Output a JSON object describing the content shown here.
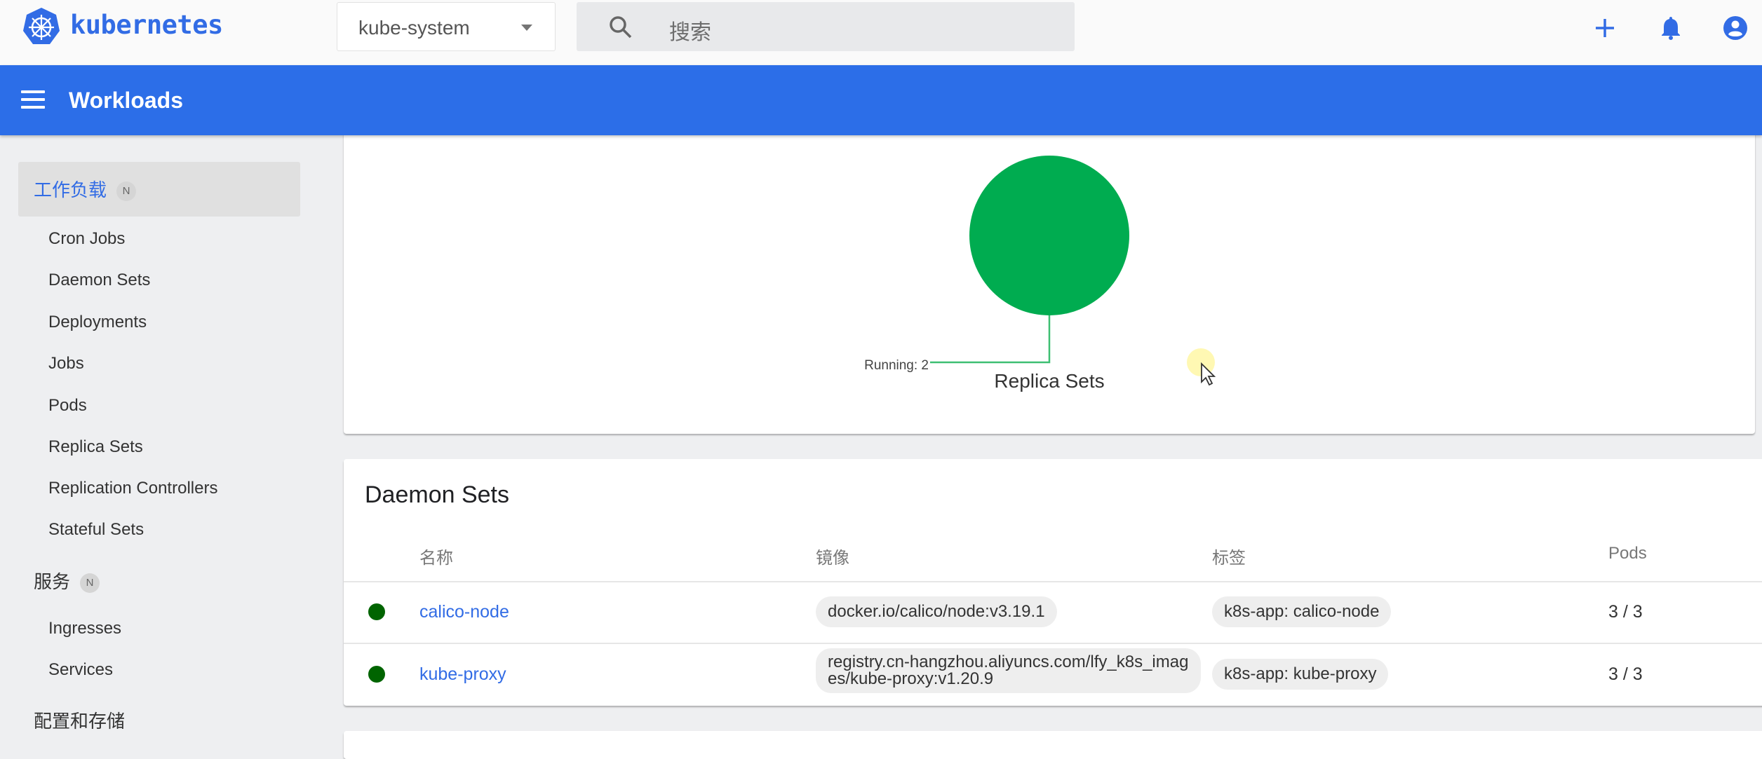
{
  "app": {
    "brand": "kubernetes",
    "brand_color": "#326ce5",
    "namespace_select": {
      "value": "kube-system"
    },
    "search": {
      "placeholder": "搜索"
    },
    "toolbar_icons": [
      "plus-icon",
      "bell-icon",
      "account-icon"
    ]
  },
  "appbar": {
    "title": "Workloads",
    "color": "#2c6ee8"
  },
  "sidebar": {
    "sections": [
      {
        "label": "工作负载",
        "badge": "N",
        "active": true,
        "items": [
          "Cron Jobs",
          "Daemon Sets",
          "Deployments",
          "Jobs",
          "Pods",
          "Replica Sets",
          "Replication Controllers",
          "Stateful Sets"
        ]
      },
      {
        "label": "服务",
        "badge": "N",
        "active": false,
        "items": [
          "Ingresses",
          "Services"
        ]
      },
      {
        "label": "配置和存储",
        "active": false,
        "items": []
      }
    ]
  },
  "replica_sets_chart": {
    "title": "Replica Sets",
    "label": "Running: 2"
  },
  "chart_data": {
    "type": "pie",
    "title": "Replica Sets",
    "slices": [
      {
        "label": "Running",
        "value": 2,
        "color": "#00ac50"
      }
    ],
    "annotations": [
      "Running: 2"
    ]
  },
  "daemon_sets": {
    "title": "Daemon Sets",
    "columns": [
      "名称",
      "镜像",
      "标签",
      "Pods"
    ],
    "rows": [
      {
        "status": "running",
        "name": "calico-node",
        "image": "docker.io/calico/node:v3.19.1",
        "label": "k8s-app: calico-node",
        "pods": "3 / 3"
      },
      {
        "status": "running",
        "name": "kube-proxy",
        "image": "registry.cn-hangzhou.aliyuncs.com/lfy_k8s_images/kube-proxy:v1.20.9",
        "label": "k8s-app: kube-proxy",
        "pods": "3 / 3"
      }
    ],
    "status_color": "#006400"
  }
}
